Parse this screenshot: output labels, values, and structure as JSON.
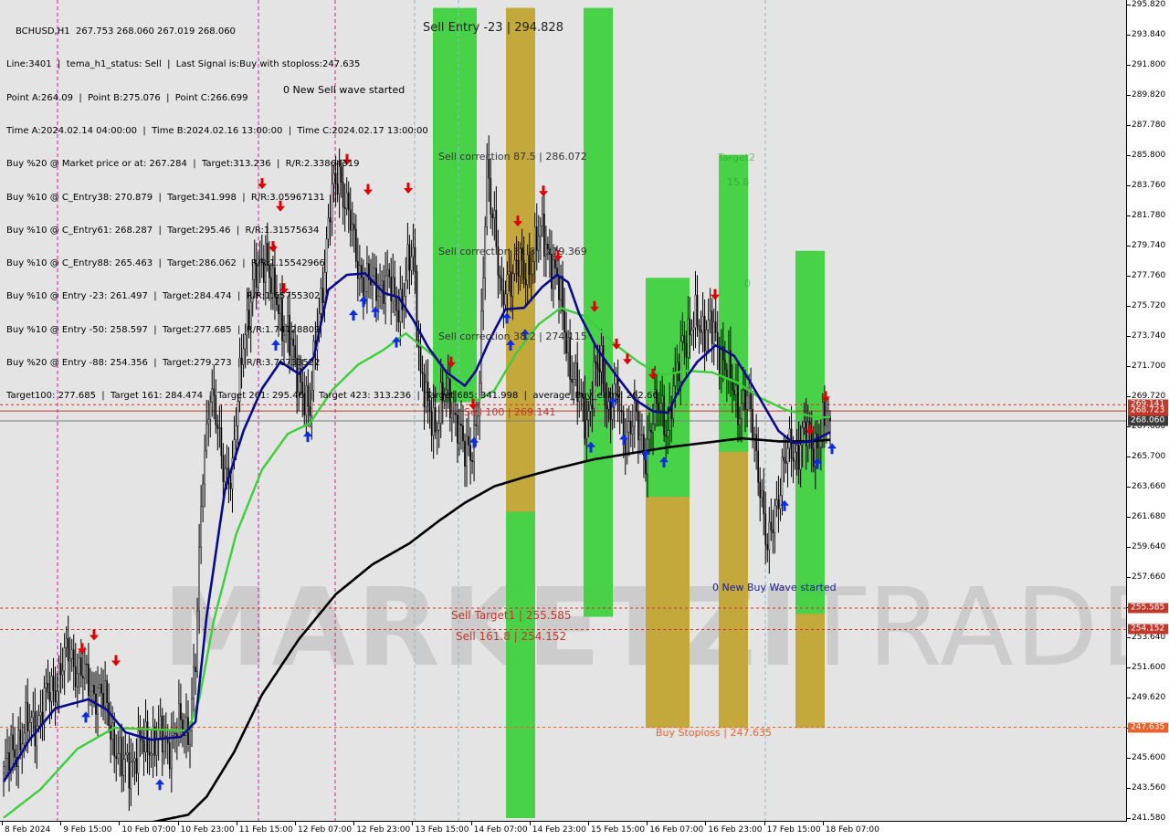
{
  "symbol_line": "BCHUSD,H1  267.753 268.060 267.019 268.060",
  "info_lines": [
    "Line:3401  |  tema_h1_status: Sell  |  Last Signal is:Buy with stoploss:247.635",
    "Point A:264.09  |  Point B:275.076  |  Point C:266.699",
    "Time A:2024.02.14 04:00:00  |  Time B:2024.02.16 13:00:00  |  Time C:2024.02.17 13:00:00",
    "Buy %20 @ Market price or at: 267.284  |  Target:313.236  |  R/R:2.33864319",
    "Buy %10 @ C_Entry38: 270.879  |  Target:341.998  |  R/R:3.05967131",
    "Buy %10 @ C_Entry61: 268.287  |  Target:295.46  |  R/R:1.31575634",
    "Buy %10 @ C_Entry88: 265.463  |  Target:286.062  |  R/R:1.15542966",
    "Buy %10 @ Entry -23: 261.497  |  Target:284.474  |  R/R:1.65755302",
    "Buy %10 @ Entry -50: 258.597  |  Target:277.685  |  R/R:1.74128809",
    "Buy %20 @ Entry -88: 254.356  |  Target:279.273  |  R/R:3.70733522",
    "Target100: 277.685  |  Target 161: 284.474  |  Target 261: 295.46  |  Target 423: 313.236  |  Target 685: 341.998  |  average_Buy_entry: 262.66"
  ],
  "watermark": {
    "bold": "MARKETZI",
    "light": "TRADE"
  },
  "annotations": {
    "sell_entry": "Sell Entry -23 | 294.828",
    "new_sell_wave": "0 New Sell wave started",
    "sell_corr_875": "Sell correction 87.5 | 286.072",
    "sell_corr_618": "Sell correction 61.8 | 279.369",
    "sell_corr_382": "Sell correction 38.2 | 274.115",
    "sell_100": "Sell 100 | 269.141",
    "sell_target1": "Sell Target1 | 255.585",
    "sell_1618": "Sell 161.8 | 254.152",
    "new_buy_wave": "0 New Buy Wave started",
    "buy_stoploss": "Buy Stoploss | 247.635",
    "faint_1": "Target2",
    "faint_2": "15.8",
    "faint_3": "0"
  },
  "colors": {
    "bg": "#e4e4e4",
    "bull": "#000000",
    "bear": "#000000",
    "ema_fast": "#0a0a8c",
    "ema_mid": "#3ccf3c",
    "ema_slow": "#000000",
    "level_red": "#c0392b",
    "level_orange": "#e8642c",
    "magenta": "#cc2299",
    "band_green": "#3fd13f",
    "band_orange": "#d9a23a"
  },
  "chart_data": {
    "type": "candlestick",
    "symbol": "BCHUSD",
    "timeframe": "H1",
    "ylim": [
      241.58,
      295.82
    ],
    "y_ticks": [
      295.82,
      293.84,
      291.8,
      289.82,
      287.78,
      285.8,
      283.76,
      281.78,
      279.74,
      277.76,
      275.72,
      273.74,
      271.7,
      269.72,
      267.68,
      265.7,
      263.66,
      261.68,
      259.64,
      257.66,
      255.62,
      253.64,
      251.6,
      249.62,
      247.58,
      245.6,
      243.56,
      241.58
    ],
    "x_labels": [
      "8 Feb 2024",
      "9 Feb 15:00",
      "10 Feb 07:00",
      "10 Feb 23:00",
      "11 Feb 15:00",
      "12 Feb 07:00",
      "12 Feb 23:00",
      "13 Feb 15:00",
      "14 Feb 07:00",
      "14 Feb 23:00",
      "15 Feb 15:00",
      "16 Feb 07:00",
      "16 Feb 23:00",
      "17 Feb 15:00",
      "18 Feb 07:00"
    ],
    "price_levels": [
      {
        "label": "269.141",
        "value": 269.141,
        "color": "#c0392b",
        "style": "dashed"
      },
      {
        "label": "268.723",
        "value": 268.723,
        "color": "#c0392b",
        "style": "solid"
      },
      {
        "label": "268.060",
        "value": 268.06,
        "color": "#7a7a7a",
        "style": "solid"
      },
      {
        "label": "255.585",
        "value": 255.585,
        "color": "#c0392b",
        "style": "dashed"
      },
      {
        "label": "254.152",
        "value": 254.152,
        "color": "#c0392b",
        "style": "dashed"
      },
      {
        "label": "247.635",
        "value": 247.635,
        "color": "#e8642c",
        "style": "dashed"
      }
    ],
    "close_anchors": [
      [
        0,
        244.5
      ],
      [
        8,
        246.8
      ],
      [
        20,
        248.6
      ],
      [
        30,
        251.2
      ],
      [
        36,
        252.6
      ],
      [
        44,
        250.7
      ],
      [
        50,
        250.2
      ],
      [
        56,
        248.9
      ],
      [
        64,
        244.8
      ],
      [
        72,
        245.9
      ],
      [
        80,
        246.9
      ],
      [
        88,
        246.6
      ],
      [
        94,
        247.4
      ],
      [
        100,
        247.6
      ],
      [
        104,
        251.8
      ],
      [
        108,
        264.8
      ],
      [
        112,
        270.6
      ],
      [
        118,
        265.4
      ],
      [
        124,
        264.5
      ],
      [
        130,
        273.9
      ],
      [
        136,
        277.2
      ],
      [
        142,
        279.6
      ],
      [
        146,
        276.3
      ],
      [
        150,
        275.1
      ],
      [
        154,
        274.3
      ],
      [
        158,
        271.2
      ],
      [
        162,
        270.7
      ],
      [
        166,
        268.4
      ],
      [
        170,
        274.5
      ],
      [
        174,
        278.6
      ],
      [
        178,
        282.9
      ],
      [
        182,
        284.9
      ],
      [
        186,
        282.1
      ],
      [
        190,
        279.8
      ],
      [
        196,
        276.9
      ],
      [
        202,
        277.4
      ],
      [
        210,
        276.8
      ],
      [
        216,
        275.9
      ],
      [
        222,
        279.7
      ],
      [
        226,
        271.2
      ],
      [
        230,
        268.5
      ],
      [
        234,
        268.1
      ],
      [
        238,
        269.6
      ],
      [
        242,
        269.3
      ],
      [
        246,
        268.3
      ],
      [
        250,
        265.4
      ],
      [
        254,
        266.5
      ],
      [
        258,
        270.3
      ],
      [
        262,
        284.6
      ],
      [
        266,
        281.8
      ],
      [
        270,
        275.2
      ],
      [
        274,
        277.9
      ],
      [
        278,
        278.8
      ],
      [
        282,
        277.4
      ],
      [
        288,
        279.9
      ],
      [
        292,
        280.3
      ],
      [
        296,
        279.4
      ],
      [
        300,
        277.3
      ],
      [
        304,
        274.4
      ],
      [
        308,
        271.4
      ],
      [
        312,
        269.3
      ],
      [
        316,
        268.3
      ],
      [
        320,
        270.8
      ],
      [
        324,
        271.7
      ],
      [
        328,
        268.9
      ],
      [
        332,
        269.7
      ],
      [
        336,
        267.4
      ],
      [
        342,
        267.9
      ],
      [
        348,
        266.2
      ],
      [
        352,
        267.9
      ],
      [
        356,
        269.7
      ],
      [
        360,
        267.4
      ],
      [
        364,
        270.3
      ],
      [
        368,
        274.1
      ],
      [
        372,
        273.4
      ],
      [
        376,
        275.1
      ],
      [
        380,
        274.3
      ],
      [
        384,
        273.9
      ],
      [
        390,
        272.5
      ],
      [
        394,
        270.4
      ],
      [
        398,
        269.1
      ],
      [
        402,
        269.8
      ],
      [
        406,
        267.5
      ],
      [
        410,
        264.3
      ],
      [
        414,
        258.9
      ],
      [
        418,
        262.2
      ],
      [
        422,
        264.8
      ],
      [
        426,
        265.9
      ],
      [
        430,
        266.3
      ],
      [
        434,
        267.1
      ],
      [
        438,
        266.4
      ],
      [
        442,
        267.1
      ],
      [
        446,
        267.9
      ],
      [
        448,
        268.06
      ]
    ],
    "ema_fast_anchors": [
      [
        0,
        244.0
      ],
      [
        14,
        246.8
      ],
      [
        28,
        248.9
      ],
      [
        46,
        249.5
      ],
      [
        56,
        248.8
      ],
      [
        66,
        247.3
      ],
      [
        80,
        246.8
      ],
      [
        96,
        247.0
      ],
      [
        104,
        248.0
      ],
      [
        110,
        255.0
      ],
      [
        120,
        263.5
      ],
      [
        130,
        267.4
      ],
      [
        140,
        270.2
      ],
      [
        150,
        272.0
      ],
      [
        160,
        271.2
      ],
      [
        168,
        272.3
      ],
      [
        176,
        276.8
      ],
      [
        186,
        277.8
      ],
      [
        196,
        277.9
      ],
      [
        206,
        276.6
      ],
      [
        214,
        276.3
      ],
      [
        222,
        274.8
      ],
      [
        230,
        273.0
      ],
      [
        240,
        271.3
      ],
      [
        250,
        270.4
      ],
      [
        256,
        271.4
      ],
      [
        264,
        273.6
      ],
      [
        272,
        275.5
      ],
      [
        282,
        275.6
      ],
      [
        292,
        277.0
      ],
      [
        300,
        277.8
      ],
      [
        306,
        277.3
      ],
      [
        312,
        275.2
      ],
      [
        322,
        272.8
      ],
      [
        332,
        271.1
      ],
      [
        342,
        269.5
      ],
      [
        352,
        268.7
      ],
      [
        360,
        268.6
      ],
      [
        368,
        270.6
      ],
      [
        376,
        272.0
      ],
      [
        386,
        273.1
      ],
      [
        396,
        272.4
      ],
      [
        404,
        270.8
      ],
      [
        412,
        269.1
      ],
      [
        420,
        267.4
      ],
      [
        428,
        266.6
      ],
      [
        438,
        266.7
      ],
      [
        448,
        267.3
      ]
    ],
    "ema_mid_anchors": [
      [
        0,
        241.6
      ],
      [
        20,
        243.5
      ],
      [
        40,
        246.2
      ],
      [
        60,
        247.6
      ],
      [
        80,
        247.5
      ],
      [
        100,
        247.4
      ],
      [
        106,
        249.5
      ],
      [
        114,
        254.8
      ],
      [
        126,
        260.5
      ],
      [
        140,
        264.8
      ],
      [
        154,
        267.2
      ],
      [
        166,
        267.9
      ],
      [
        178,
        270.1
      ],
      [
        192,
        271.8
      ],
      [
        206,
        272.8
      ],
      [
        218,
        273.9
      ],
      [
        232,
        272.5
      ],
      [
        246,
        270.4
      ],
      [
        256,
        269.4
      ],
      [
        266,
        270.1
      ],
      [
        278,
        272.6
      ],
      [
        290,
        274.5
      ],
      [
        302,
        275.6
      ],
      [
        316,
        275.0
      ],
      [
        330,
        273.3
      ],
      [
        344,
        272.0
      ],
      [
        356,
        271.1
      ],
      [
        370,
        271.4
      ],
      [
        384,
        271.3
      ],
      [
        398,
        270.6
      ],
      [
        410,
        269.6
      ],
      [
        424,
        268.8
      ],
      [
        440,
        268.3
      ],
      [
        448,
        268.3
      ]
    ],
    "ema_slow_anchors": [
      [
        0,
        240.0
      ],
      [
        40,
        240.6
      ],
      [
        80,
        241.3
      ],
      [
        100,
        241.8
      ],
      [
        110,
        243.0
      ],
      [
        125,
        246.0
      ],
      [
        140,
        249.8
      ],
      [
        160,
        253.5
      ],
      [
        180,
        256.5
      ],
      [
        200,
        258.5
      ],
      [
        220,
        259.9
      ],
      [
        236,
        261.4
      ],
      [
        250,
        262.6
      ],
      [
        266,
        263.7
      ],
      [
        282,
        264.3
      ],
      [
        300,
        264.9
      ],
      [
        320,
        265.5
      ],
      [
        340,
        265.9
      ],
      [
        360,
        266.3
      ],
      [
        380,
        266.6
      ],
      [
        400,
        266.9
      ],
      [
        420,
        266.7
      ],
      [
        436,
        266.7
      ],
      [
        448,
        266.8
      ]
    ],
    "bands": [
      {
        "x0": 474,
        "x1": 522,
        "type": "green",
        "top": 295.6,
        "bottom": 269.3
      },
      {
        "x0": 554,
        "x1": 586,
        "type": "green-orange",
        "top": 295.6,
        "bottom": 241.58,
        "orange_top": 295.6,
        "orange_bottom": 262.0
      },
      {
        "x0": 639,
        "x1": 671,
        "type": "green",
        "top": 295.6,
        "bottom": 255.0
      },
      {
        "x0": 707,
        "x1": 755,
        "type": "green-orange",
        "top": 277.6,
        "bottom": 247.6,
        "orange_top": 263.0,
        "orange_bottom": 247.6
      },
      {
        "x0": 787,
        "x1": 819,
        "type": "green-orange",
        "top": 285.8,
        "bottom": 247.6,
        "orange_top": 266.0,
        "orange_bottom": 247.6
      },
      {
        "x0": 871,
        "x1": 903,
        "type": "green-orange",
        "top": 279.4,
        "bottom": 247.6,
        "orange_top": 255.2,
        "orange_bottom": 247.6
      }
    ],
    "magenta_lines_x": [
      63,
      283,
      367
    ],
    "cyan_lines_x": [
      454,
      502,
      838
    ],
    "sell_arrows": [
      [
        90,
        252.7
      ],
      [
        103,
        253.6
      ],
      [
        127,
        251.9
      ],
      [
        287,
        283.7
      ],
      [
        307,
        282.2
      ],
      [
        299,
        279.5
      ],
      [
        311,
        276.7
      ],
      [
        380,
        285.3
      ],
      [
        403,
        283.3
      ],
      [
        447,
        283.4
      ],
      [
        494,
        271.8
      ],
      [
        518,
        269.0
      ],
      [
        567,
        281.2
      ],
      [
        595,
        283.2
      ],
      [
        611,
        278.9
      ],
      [
        651,
        275.5
      ],
      [
        675,
        273.0
      ],
      [
        687,
        272.0
      ],
      [
        715,
        271.0
      ],
      [
        783,
        276.3
      ],
      [
        887,
        267.3
      ],
      [
        904,
        269.5
      ]
    ],
    "buy_arrows": [
      [
        94,
        248.5
      ],
      [
        175,
        244.0
      ],
      [
        302,
        273.3
      ],
      [
        337,
        267.2
      ],
      [
        387,
        275.3
      ],
      [
        398,
        276.2
      ],
      [
        411,
        275.5
      ],
      [
        434,
        273.5
      ],
      [
        519,
        266.8
      ],
      [
        555,
        275.1
      ],
      [
        559,
        273.3
      ],
      [
        575,
        274.0
      ],
      [
        647,
        266.5
      ],
      [
        671,
        269.5
      ],
      [
        683,
        267.0
      ],
      [
        707,
        266.0
      ],
      [
        727,
        265.5
      ],
      [
        859,
        262.6
      ],
      [
        895,
        265.4
      ],
      [
        911,
        266.4
      ]
    ]
  }
}
